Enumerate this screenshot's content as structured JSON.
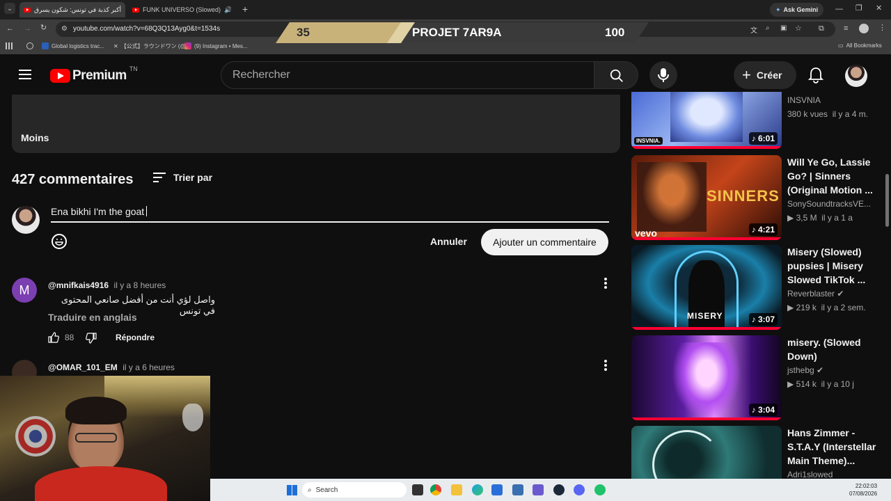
{
  "browser": {
    "tabs": [
      {
        "title": "أكبر كذبة في تونس: شكون يسرق",
        "active": true
      },
      {
        "title": "FUNK UNIVERSO (Slowed)",
        "active": false
      }
    ],
    "new_tab": "+",
    "ask_gemini": "Ask Gemini",
    "url": "youtube.com/watch?v=68Q3Q13Ayg0&t=1534s",
    "bookmarks": [
      {
        "label": "Global logistics trac..."
      },
      {
        "label": "【公式】ラウンドワン (@..."
      },
      {
        "label": "(9) Instagram • Mes..."
      }
    ],
    "all_bookmarks": "All Bookmarks"
  },
  "overlay": {
    "left_number": "35",
    "title": "PROJET 7AR9A",
    "right_number": "100"
  },
  "youtube": {
    "logo_text": "Premium",
    "country": "TN",
    "search_placeholder": "Rechercher",
    "create_label": "Créer"
  },
  "description": {
    "less": "Moins"
  },
  "comments": {
    "count_label": "427 commentaires",
    "sort_label": "Trier par",
    "draft": "Ena bikhi I'm the goat",
    "cancel": "Annuler",
    "submit": "Ajouter un commentaire",
    "items": [
      {
        "avatar_letter": "M",
        "author": "@mnifkais4916",
        "time": "il y a 8 heures",
        "text": "واصل لؤي أنت من أفضل صانعي المحتوى في تونس",
        "translate": "Traduire en anglais",
        "likes": "88",
        "reply": "Répondre"
      },
      {
        "author": "@OMAR_101_EM",
        "time": "il y a 6 heures"
      }
    ]
  },
  "related": [
    {
      "title": "",
      "channel": "INSVNIA",
      "views": "380 k",
      "age": "il y a 4 m.",
      "duration": "6:01",
      "thumb_text": "INSVNIA."
    },
    {
      "title": "Will Ye Go, Lassie Go? | Sinners (Original Motion ...",
      "channel": "SonySoundtracksVE...",
      "views": "3,5 M",
      "age": "il y a 1 a",
      "duration": "4:21",
      "thumb_text": "SINNERS",
      "thumb_brand": "vevo"
    },
    {
      "title": "Misery (Slowed) pupsies | Misery Slowed TikTok ...",
      "channel": "Reverblaster",
      "views": "219 k",
      "age": "il y a 2 sem.",
      "duration": "3:07",
      "thumb_text": "MISERY"
    },
    {
      "title": "misery. (Slowed Down)",
      "channel": "jsthebg",
      "views": "514 k",
      "age": "il y a 10 j",
      "duration": "3:04"
    },
    {
      "title": "Hans Zimmer - S.T.A.Y (Interstellar Main Theme)...",
      "channel": "Adri1slowed"
    }
  ],
  "taskbar": {
    "search_label": "Search",
    "time": "22:02:03",
    "date": "07/08/2026"
  },
  "colors": {
    "youtube_red": "#ff0000",
    "progress_red": "#ff0033",
    "banner_gold": "#c9b27a"
  }
}
